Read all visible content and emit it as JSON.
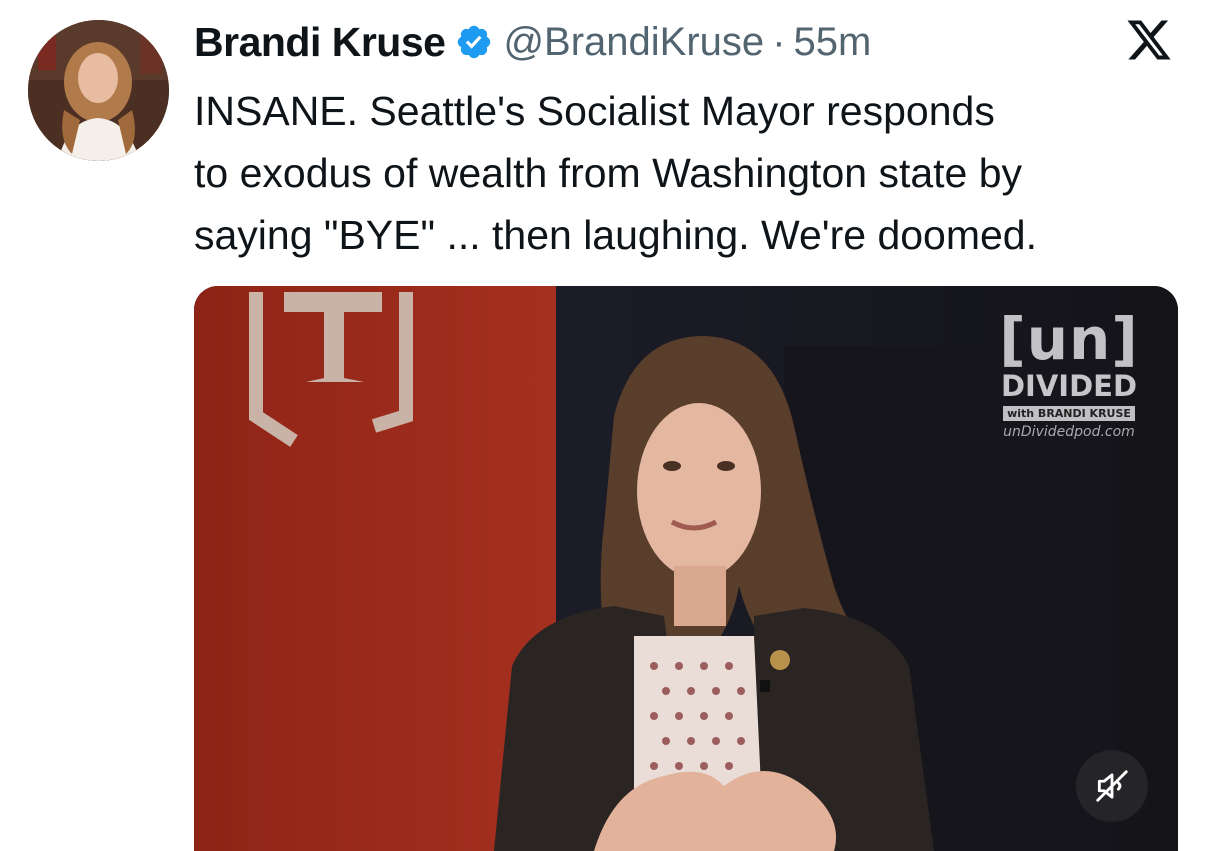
{
  "author": {
    "name": "Brandi Kruse",
    "handle": "@BrandiKruse",
    "separator": "·",
    "time": "55m",
    "verified": true
  },
  "platform_icon": "x-logo-icon",
  "tweet": {
    "lines": [
      "INSANE. Seattle's Socialist Mayor responds",
      "to exodus of wealth from Washington state by",
      "saying \"BYE\" ... then laughing. We're doomed."
    ]
  },
  "video": {
    "watermark": {
      "brand_top": "[un]",
      "brand_bottom": "DIVIDED",
      "with_line": "with BRANDI KRUSE",
      "url": "unDividedpod.com"
    },
    "mute_icon": "speaker-muted-icon"
  },
  "colors": {
    "verified": "#1d9bf0",
    "muted_text": "#536471",
    "text": "#0f1419",
    "backdrop_red": "#9a2a1c"
  }
}
